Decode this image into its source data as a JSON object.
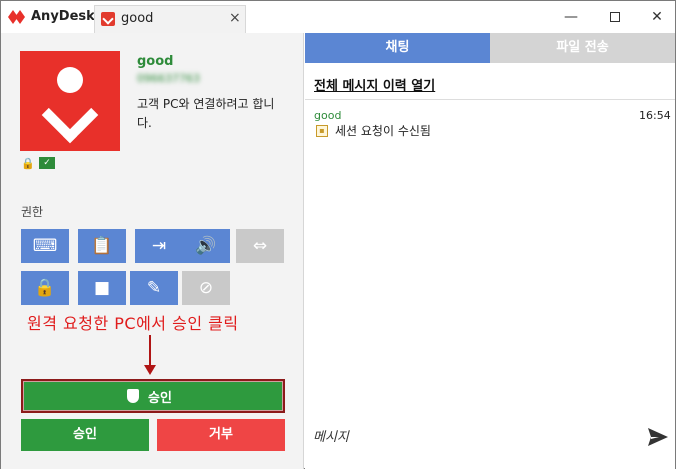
{
  "app": {
    "name": "AnyDesk"
  },
  "tab": {
    "label": "good",
    "close": "×"
  },
  "window": {
    "minimize": "—",
    "close": "✕"
  },
  "peer": {
    "name": "good",
    "id": "096637763",
    "message": "고객 PC와 연결하려고 합니다."
  },
  "permissions": {
    "label": "권한",
    "items": [
      {
        "icon": "keyboard-mouse-icon",
        "glyph": "⌨",
        "enabled": true
      },
      {
        "icon": "clipboard-icon",
        "glyph": "📋",
        "enabled": true
      },
      {
        "icon": "file-transfer-icon",
        "glyph": "⇥",
        "enabled": true
      },
      {
        "icon": "sound-icon",
        "glyph": "🔊",
        "enabled": true
      },
      {
        "icon": "switch-sides-icon",
        "glyph": "⇔",
        "enabled": false
      },
      {
        "icon": "lock-screen-icon",
        "glyph": "🔒",
        "enabled": true
      },
      {
        "icon": "record-icon",
        "glyph": "■",
        "enabled": true
      },
      {
        "icon": "draw-icon",
        "glyph": "✎",
        "enabled": true
      },
      {
        "icon": "privacy-mode-icon",
        "glyph": "⊘",
        "enabled": false
      }
    ]
  },
  "annotation": {
    "text": "원격 요청한 PC에서 승인 클릭"
  },
  "actions": {
    "approve_highlight": "승인",
    "accept": "승인",
    "reject": "거부"
  },
  "chat": {
    "tabs": [
      "채팅",
      "파일 전송"
    ],
    "history_link": "전체 메시지 이력 열기",
    "messages": [
      {
        "sender": "good",
        "time": "16:54",
        "text": "세션 요청이 수신됨"
      }
    ],
    "input_placeholder": "메시지"
  },
  "colors": {
    "accent_blue": "#5b86d3",
    "approve_green": "#2e9a3e",
    "reject_red": "#ef4545",
    "brand_red": "#e8302a",
    "annotation_red": "#e01c1c"
  }
}
